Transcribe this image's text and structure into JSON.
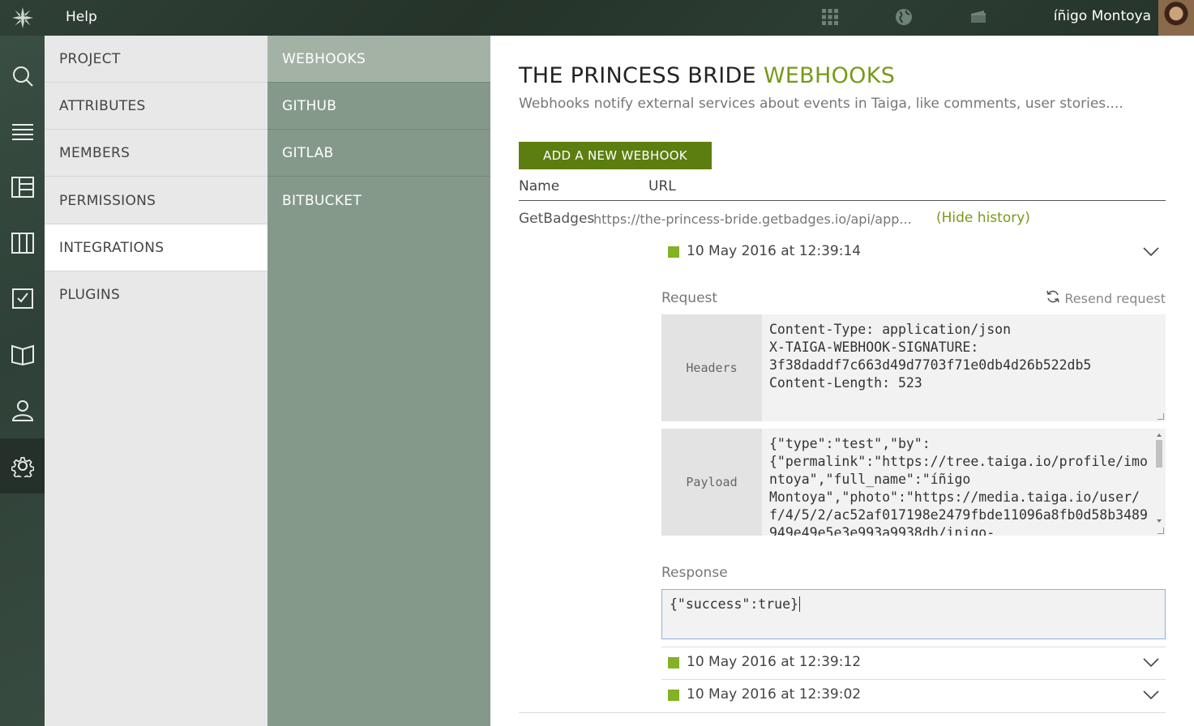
{
  "topbar": {
    "help_label": "Help",
    "username": "íñigo Montoya",
    "icons": [
      "taiga-logo-icon",
      "projects-grid-icon",
      "globe-icon",
      "folder-icon"
    ]
  },
  "rail": {
    "icons": [
      "search-icon",
      "backlog-icon",
      "kanban-icon",
      "issues-icon",
      "tasks-icon",
      "wiki-icon",
      "team-icon",
      "settings-icon"
    ],
    "active": "settings-icon"
  },
  "menu1": {
    "items": [
      "PROJECT",
      "ATTRIBUTES",
      "MEMBERS",
      "PERMISSIONS",
      "INTEGRATIONS",
      "PLUGINS"
    ],
    "active": "INTEGRATIONS"
  },
  "menu2": {
    "items": [
      "WEBHOOKS",
      "GITHUB",
      "GITLAB",
      "BITBUCKET"
    ],
    "active": "WEBHOOKS"
  },
  "main": {
    "title_project": "THE PRINCESS BRIDE",
    "title_section": "WEBHOOKS",
    "subtitle": "Webhooks notify external services about events in Taiga, like comments, user stories....",
    "add_button": "ADD A NEW WEBHOOK",
    "columns": {
      "name": "Name",
      "url": "URL"
    },
    "webhook": {
      "name": "GetBadges",
      "url": "https://the-princess-bride.getbadges.io/api/app...",
      "hide_history": "(Hide history)"
    },
    "logs": [
      {
        "date": "10 May 2016 at 12:39:14",
        "status_color": "#83b224",
        "expanded": true
      },
      {
        "date": "10 May 2016 at 12:39:12",
        "status_color": "#83b224",
        "expanded": false
      },
      {
        "date": "10 May 2016 at 12:39:02",
        "status_color": "#83b224",
        "expanded": false
      }
    ],
    "request_label": "Request",
    "resend_label": "Resend request",
    "headers_label": "Headers",
    "headers_text": "Content-Type: application/json\nX-TAIGA-WEBHOOK-SIGNATURE:\n3f38daddf7c663d49d7703f71e0db4d26b522db5\nContent-Length: 523",
    "payload_label": "Payload",
    "payload_text": "{\"type\":\"test\",\"by\":\n{\"permalink\":\"https://tree.taiga.io/profile/imontoya\",\"full_name\":\"íñigo\nMontoya\",\"photo\":\"https://media.taiga.io/user/f/4/5/2/ac52af017198e2479fbde11096a8fb0d58b3489949e49e5e3e993a9938db/inigo-",
    "response_label": "Response",
    "response_text": "{\"success\":true}"
  },
  "colors": {
    "accent": "#779a19",
    "button": "#5c7e10",
    "status_ok": "#83b224"
  }
}
